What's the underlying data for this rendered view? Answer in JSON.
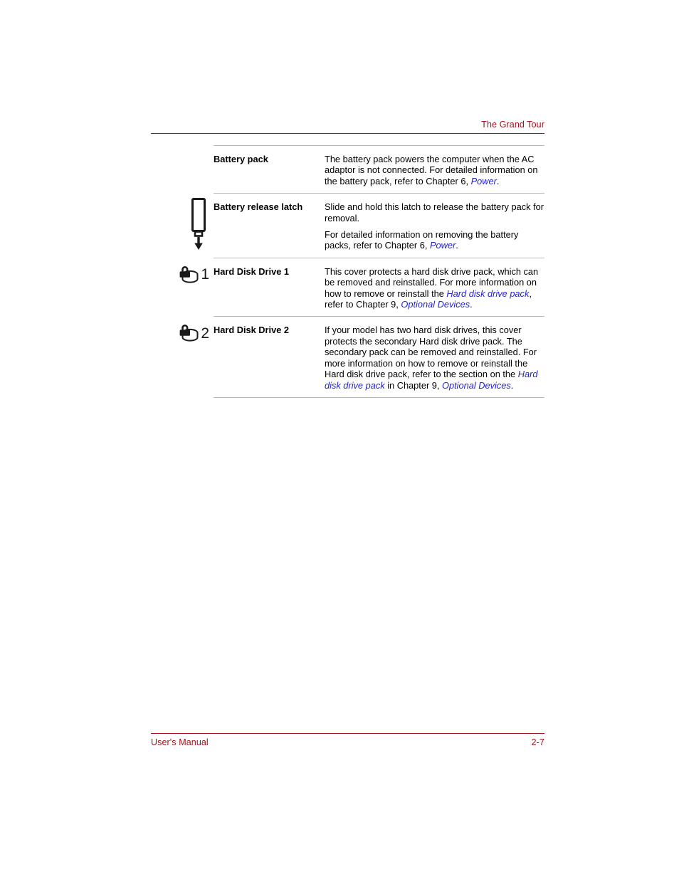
{
  "header": {
    "title": "The Grand Tour",
    "rule_color": "#A3121C"
  },
  "footer": {
    "left": "User's Manual",
    "page_number": "2-7",
    "rule_color": "#A3121C"
  },
  "colors": {
    "header_red": "#A3121C",
    "link_blue": "#2323CC",
    "rule_gray": "#b9b9b9",
    "text_black": "#000000"
  },
  "table": {
    "rows": [
      {
        "icon": null,
        "icon_number": null,
        "label": "Battery pack",
        "paragraphs": [
          [
            {
              "t": "The battery pack powers the computer when the AC adaptor is not connected. For detailed information on the battery pack, refer to Chapter 6, ",
              "style": "normal"
            },
            {
              "t": "Power",
              "style": "link"
            },
            {
              "t": ".",
              "style": "normal"
            }
          ]
        ]
      },
      {
        "icon": "battery-release-latch-icon",
        "icon_number": null,
        "label": "Battery release latch",
        "paragraphs": [
          [
            {
              "t": "Slide and hold this latch to release the battery pack for removal.",
              "style": "normal"
            }
          ],
          [
            {
              "t": "For detailed information on removing the battery packs, refer to Chapter 6, ",
              "style": "normal"
            },
            {
              "t": "Power",
              "style": "link"
            },
            {
              "t": ".",
              "style": "normal"
            }
          ]
        ]
      },
      {
        "icon": "hard-disk-drive-lock-icon",
        "icon_number": "1",
        "label": "Hard Disk Drive 1",
        "paragraphs": [
          [
            {
              "t": "This cover protects a hard disk drive pack, which can be removed and reinstalled. For more information on how to remove or reinstall the ",
              "style": "normal"
            },
            {
              "t": "Hard disk drive pack",
              "style": "link"
            },
            {
              "t": ", refer to Chapter 9, ",
              "style": "normal"
            },
            {
              "t": "Optional Devices",
              "style": "link"
            },
            {
              "t": ".",
              "style": "normal"
            }
          ]
        ]
      },
      {
        "icon": "hard-disk-drive-lock-icon",
        "icon_number": "2",
        "label": "Hard Disk Drive 2",
        "paragraphs": [
          [
            {
              "t": "If your model has two hard disk drives, this cover protects the secondary Hard disk drive pack. The secondary pack can be removed and reinstalled. For more information on how to remove or reinstall the Hard disk drive pack, refer to the section on the ",
              "style": "normal"
            },
            {
              "t": "Hard disk drive pack",
              "style": "link"
            },
            {
              "t": " in Chapter 9, ",
              "style": "normal"
            },
            {
              "t": "Optional Devices",
              "style": "link"
            },
            {
              "t": ".",
              "style": "normal"
            }
          ]
        ]
      }
    ]
  }
}
